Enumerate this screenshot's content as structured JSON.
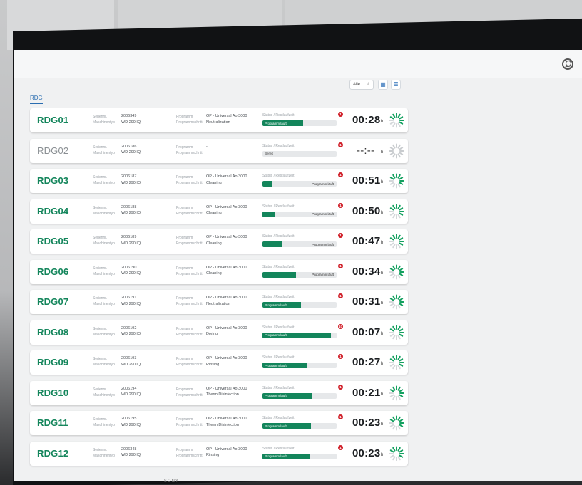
{
  "tab": "RDG",
  "filter": {
    "value": "Alle"
  },
  "labels": {
    "serial": "Seriennr.",
    "machine_type": "Maschinentyp",
    "program": "Programm",
    "step": "Programmschritt",
    "status": "Status / Restlaufzeit",
    "hour_unit": "h"
  },
  "colors": {
    "accent": "#13855b",
    "error": "#d0202a",
    "link": "#2a6db0"
  },
  "machines": [
    {
      "name": "RDG01",
      "serial": "2006349",
      "type": "WD 290 IQ",
      "program": "OP - Universal Ao 3000",
      "step": "Neutralization",
      "status_text": "Programm läuft",
      "progress": 0.55,
      "label_inside": true,
      "error": "1",
      "time": "00:28",
      "state": "running"
    },
    {
      "name": "RDG02",
      "serial": "2006186",
      "type": "WD 290 IQ",
      "program": "-",
      "step": "-",
      "status_text": "Bereit",
      "progress": 0.0,
      "label_inside": false,
      "error": "1",
      "time": "--:--",
      "state": "idle"
    },
    {
      "name": "RDG03",
      "serial": "2006187",
      "type": "WD 290 IQ",
      "program": "OP - Universal Ao 3000",
      "step": "Cleaning",
      "status_text": "Programm läuft",
      "progress": 0.13,
      "label_inside": false,
      "error": "1",
      "time": "00:51",
      "state": "running"
    },
    {
      "name": "RDG04",
      "serial": "2006188",
      "type": "WD 290 IQ",
      "program": "OP - Universal Ao 3000",
      "step": "Cleaning",
      "status_text": "Programm läuft",
      "progress": 0.17,
      "label_inside": false,
      "error": "1",
      "time": "00:50",
      "state": "running"
    },
    {
      "name": "RDG05",
      "serial": "2006189",
      "type": "WD 290 IQ",
      "program": "OP - Universal Ao 3000",
      "step": "Cleaning",
      "status_text": "Programm läuft",
      "progress": 0.27,
      "label_inside": false,
      "error": "1",
      "time": "00:47",
      "state": "running"
    },
    {
      "name": "RDG06",
      "serial": "2006190",
      "type": "WD 290 IQ",
      "program": "OP - Universal Ao 3000",
      "step": "Cleaning",
      "status_text": "Programm läuft",
      "progress": 0.45,
      "label_inside": false,
      "error": "1",
      "time": "00:34",
      "state": "running"
    },
    {
      "name": "RDG07",
      "serial": "2006191",
      "type": "WD 290 IQ",
      "program": "OP - Universal Ao 3000",
      "step": "Neutralization",
      "status_text": "Programm läuft",
      "progress": 0.52,
      "label_inside": true,
      "error": "1",
      "time": "00:31",
      "state": "running"
    },
    {
      "name": "RDG08",
      "serial": "2006192",
      "type": "WD 290 IQ",
      "program": "OP - Universal Ao 3000",
      "step": "Drying",
      "status_text": "Programm läuft",
      "progress": 0.92,
      "label_inside": true,
      "error": "10",
      "time": "00:07",
      "state": "running"
    },
    {
      "name": "RDG09",
      "serial": "2006193",
      "type": "WD 290 IQ",
      "program": "OP - Universal Ao 3000",
      "step": "Rinsing",
      "status_text": "Programm läuft",
      "progress": 0.6,
      "label_inside": true,
      "error": "1",
      "time": "00:27",
      "state": "running"
    },
    {
      "name": "RDG10",
      "serial": "2006194",
      "type": "WD 290 IQ",
      "program": "OP - Universal Ao 3000",
      "step": "Therm Disinfection",
      "status_text": "Programm läuft",
      "progress": 0.67,
      "label_inside": true,
      "error": "1",
      "time": "00:21",
      "state": "running"
    },
    {
      "name": "RDG11",
      "serial": "2006195",
      "type": "WD 290 IQ",
      "program": "OP - Universal Ao 3000",
      "step": "Therm Disinfection",
      "status_text": "Programm läuft",
      "progress": 0.65,
      "label_inside": true,
      "error": "1",
      "time": "00:23",
      "state": "running"
    },
    {
      "name": "RDG12",
      "serial": "2006348",
      "type": "WD 290 IQ",
      "program": "OP - Universal Ao 3000",
      "step": "Rinsing",
      "status_text": "Programm läuft",
      "progress": 0.63,
      "label_inside": true,
      "error": "1",
      "time": "00:23",
      "state": "running"
    }
  ],
  "brand": "SONY"
}
